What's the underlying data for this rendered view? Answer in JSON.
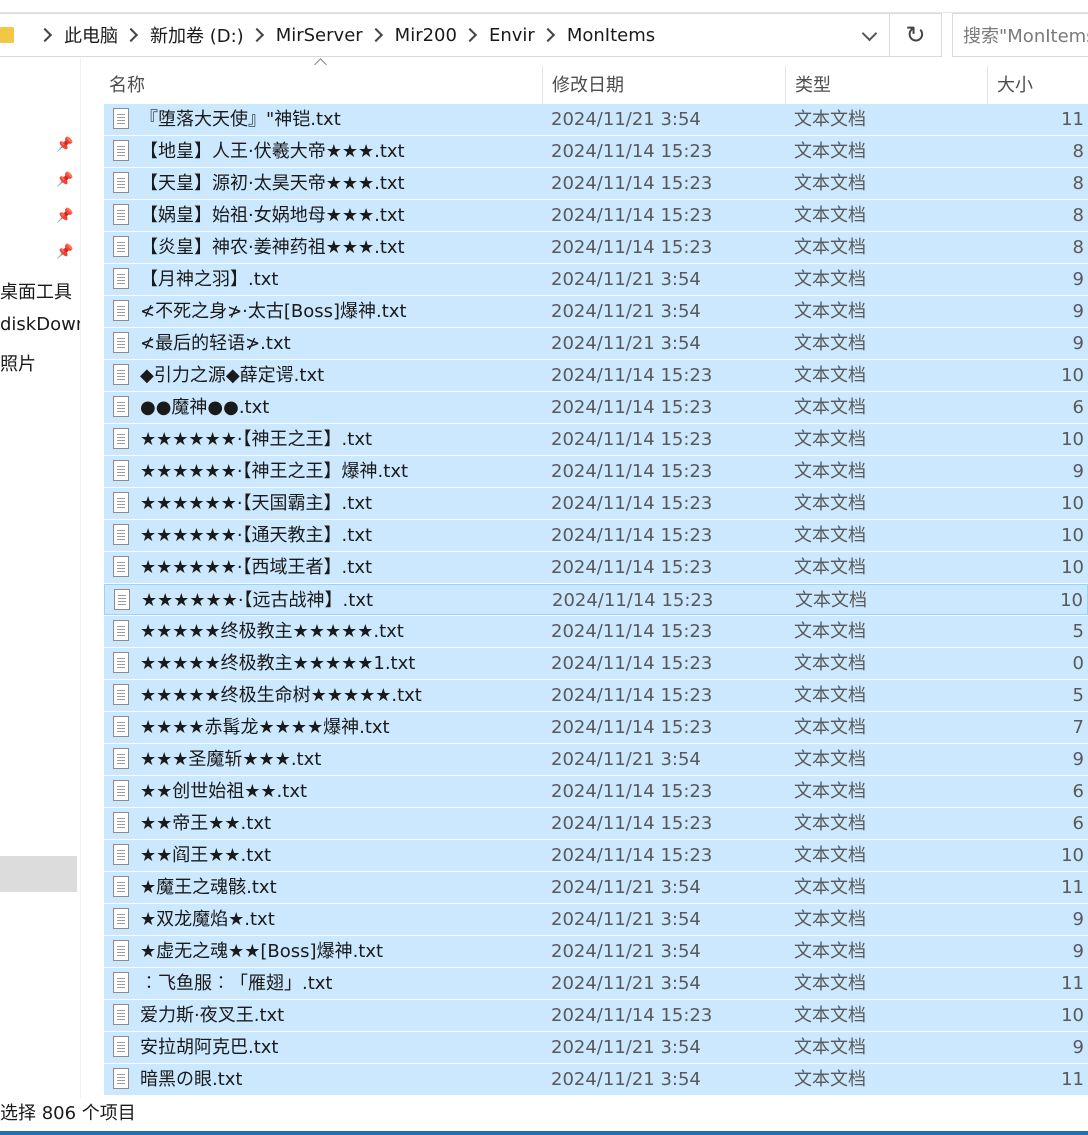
{
  "breadcrumb": [
    "此电脑",
    "新加卷 (D:)",
    "MirServer",
    "Mir200",
    "Envir",
    "MonItems"
  ],
  "search": {
    "placeholder": "搜索\"MonItems\""
  },
  "sidebar": {
    "items": [
      "桌面工具",
      "diskDown",
      "照片"
    ]
  },
  "columns": {
    "name": "名称",
    "date": "修改日期",
    "type": "类型",
    "size": "大小"
  },
  "files": [
    {
      "name": "『堕落大天使』\"神铠.txt",
      "date": "2024/11/21 3:54",
      "type": "文本文档",
      "size": "11"
    },
    {
      "name": "【地皇】人王·伏羲大帝★★★.txt",
      "date": "2024/11/14 15:23",
      "type": "文本文档",
      "size": "8"
    },
    {
      "name": "【天皇】源初·太昊天帝★★★.txt",
      "date": "2024/11/14 15:23",
      "type": "文本文档",
      "size": "8"
    },
    {
      "name": "【娲皇】始祖·女娲地母★★★.txt",
      "date": "2024/11/14 15:23",
      "type": "文本文档",
      "size": "8"
    },
    {
      "name": "【炎皇】神农·姜神药祖★★★.txt",
      "date": "2024/11/14 15:23",
      "type": "文本文档",
      "size": "8"
    },
    {
      "name": "【月神之羽】.txt",
      "date": "2024/11/21 3:54",
      "type": "文本文档",
      "size": "9"
    },
    {
      "name": "≮不死之身≯·太古[Boss]爆神.txt",
      "date": "2024/11/21 3:54",
      "type": "文本文档",
      "size": "9"
    },
    {
      "name": "≮最后的轻语≯.txt",
      "date": "2024/11/21 3:54",
      "type": "文本文档",
      "size": "9"
    },
    {
      "name": "◆引力之源◆薛定谔.txt",
      "date": "2024/11/14 15:23",
      "type": "文本文档",
      "size": "10"
    },
    {
      "name": "●●魔神●●.txt",
      "date": "2024/11/14 15:23",
      "type": "文本文档",
      "size": "6"
    },
    {
      "name": "★★★★★★·【神王之王】.txt",
      "date": "2024/11/14 15:23",
      "type": "文本文档",
      "size": "10"
    },
    {
      "name": "★★★★★★·【神王之王】爆神.txt",
      "date": "2024/11/14 15:23",
      "type": "文本文档",
      "size": "9"
    },
    {
      "name": "★★★★★★·【天国霸主】.txt",
      "date": "2024/11/14 15:23",
      "type": "文本文档",
      "size": "10"
    },
    {
      "name": "★★★★★★·【通天教主】.txt",
      "date": "2024/11/14 15:23",
      "type": "文本文档",
      "size": "10"
    },
    {
      "name": "★★★★★★·【西域王者】.txt",
      "date": "2024/11/14 15:23",
      "type": "文本文档",
      "size": "10"
    },
    {
      "name": "★★★★★★·【远古战神】.txt",
      "date": "2024/11/14 15:23",
      "type": "文本文档",
      "size": "10"
    },
    {
      "name": "★★★★★终极教主★★★★★.txt",
      "date": "2024/11/14 15:23",
      "type": "文本文档",
      "size": "5"
    },
    {
      "name": "★★★★★终极教主★★★★★1.txt",
      "date": "2024/11/14 15:23",
      "type": "文本文档",
      "size": "0"
    },
    {
      "name": "★★★★★终极生命树★★★★★.txt",
      "date": "2024/11/14 15:23",
      "type": "文本文档",
      "size": "5"
    },
    {
      "name": "★★★★赤髯龙★★★★爆神.txt",
      "date": "2024/11/14 15:23",
      "type": "文本文档",
      "size": "7"
    },
    {
      "name": "★★★圣魔斩★★★.txt",
      "date": "2024/11/21 3:54",
      "type": "文本文档",
      "size": "9"
    },
    {
      "name": "★★创世始祖★★.txt",
      "date": "2024/11/14 15:23",
      "type": "文本文档",
      "size": "6"
    },
    {
      "name": "★★帝王★★.txt",
      "date": "2024/11/14 15:23",
      "type": "文本文档",
      "size": "6"
    },
    {
      "name": "★★阎王★★.txt",
      "date": "2024/11/14 15:23",
      "type": "文本文档",
      "size": "10"
    },
    {
      "name": "★魔王之魂骸.txt",
      "date": "2024/11/21 3:54",
      "type": "文本文档",
      "size": "11"
    },
    {
      "name": "★双龙魔焰★.txt",
      "date": "2024/11/21 3:54",
      "type": "文本文档",
      "size": "9"
    },
    {
      "name": "★虚无之魂★★[Boss]爆神.txt",
      "date": "2024/11/21 3:54",
      "type": "文本文档",
      "size": "9"
    },
    {
      "name": "︰飞鱼服︰「雁翅」.txt",
      "date": "2024/11/21 3:54",
      "type": "文本文档",
      "size": "11"
    },
    {
      "name": "爱力斯·夜叉王.txt",
      "date": "2024/11/14 15:23",
      "type": "文本文档",
      "size": "10"
    },
    {
      "name": "安拉胡阿克巴.txt",
      "date": "2024/11/21 3:54",
      "type": "文本文档",
      "size": "9"
    },
    {
      "name": "暗黑の眼.txt",
      "date": "2024/11/21 3:54",
      "type": "文本文档",
      "size": "11"
    }
  ],
  "status": {
    "text": "选择 806 个项目"
  },
  "icons": {
    "folder": "folder-icon",
    "file": "text-file-icon",
    "pin": "pin-icon",
    "refresh": "refresh-icon"
  },
  "colors": {
    "selection": "#cce8ff",
    "selection_border": "#99d1ff",
    "folder": "#f2c744"
  }
}
